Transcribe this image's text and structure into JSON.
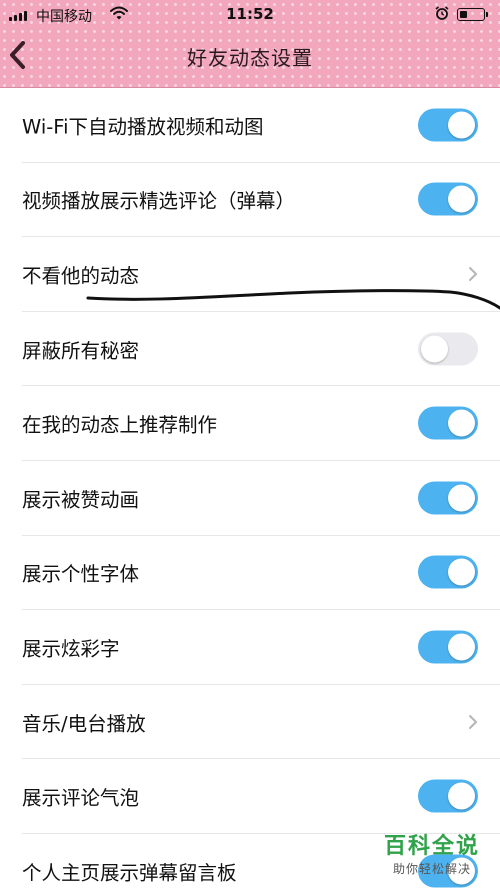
{
  "status_bar": {
    "carrier": "中国移动",
    "time": "11:52",
    "battery_level": 0.35,
    "icons": [
      "signal-icon",
      "wifi-icon",
      "alarm-icon",
      "battery-icon"
    ]
  },
  "header": {
    "title": "好友动态设置",
    "back_icon": "back-chevron-icon",
    "background_color": "#f2a7bd"
  },
  "accent_color": "#4db3f0",
  "settings": [
    {
      "label": "Wi-Fi下自动播放视频和动图",
      "type": "toggle",
      "value": true
    },
    {
      "label": "视频播放展示精选评论（弹幕）",
      "type": "toggle",
      "value": true
    },
    {
      "label": "不看他的动态",
      "type": "link"
    },
    {
      "label": "屏蔽所有秘密",
      "type": "toggle",
      "value": false
    },
    {
      "label": "在我的动态上推荐制作",
      "type": "toggle",
      "value": true
    },
    {
      "label": "展示被赞动画",
      "type": "toggle",
      "value": true
    },
    {
      "label": "展示个性字体",
      "type": "toggle",
      "value": true
    },
    {
      "label": "展示炫彩字",
      "type": "toggle",
      "value": true
    },
    {
      "label": "音乐/电台播放",
      "type": "link"
    },
    {
      "label": "展示评论气泡",
      "type": "toggle",
      "value": true
    },
    {
      "label": "个人主页展示弹幕留言板",
      "type": "toggle",
      "value": true
    }
  ],
  "watermark": {
    "title": "百科全说",
    "subtitle": "助你轻松解决"
  }
}
